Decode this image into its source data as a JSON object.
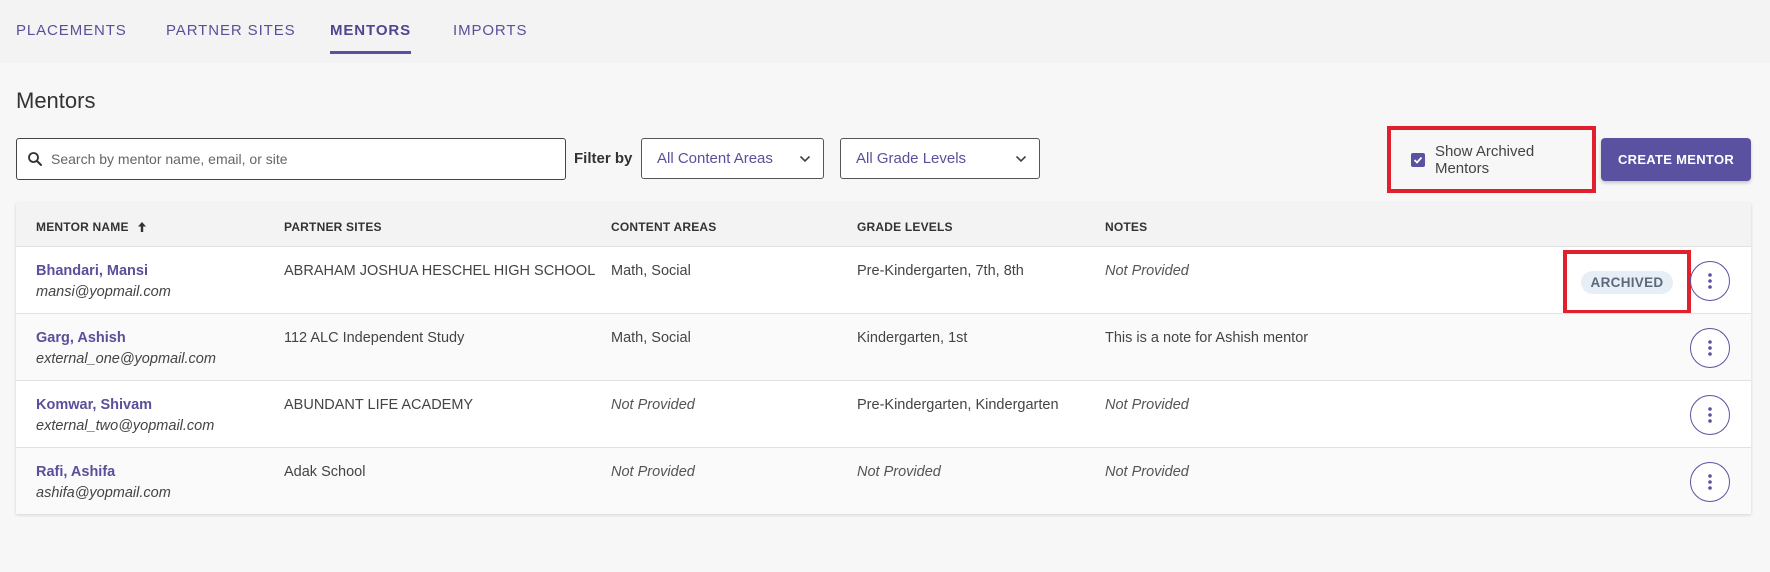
{
  "tabs": [
    {
      "label": "PLACEMENTS",
      "active": false
    },
    {
      "label": "PARTNER SITES",
      "active": false
    },
    {
      "label": "MENTORS",
      "active": true
    },
    {
      "label": "IMPORTS",
      "active": false
    }
  ],
  "page": {
    "title": "Mentors"
  },
  "toolbar": {
    "search_placeholder": "Search by mentor name, email, or site",
    "filter_label": "Filter by",
    "content_area_selected": "All Content Areas",
    "grade_level_selected": "All Grade Levels",
    "show_archived_label": "Show Archived Mentors",
    "show_archived_checked": true,
    "create_label": "CREATE MENTOR"
  },
  "table": {
    "headers": {
      "name": "MENTOR NAME",
      "sites": "PARTNER SITES",
      "content": "CONTENT AREAS",
      "grades": "GRADE LEVELS",
      "notes": "NOTES"
    },
    "rows": [
      {
        "name": "Bhandari, Mansi",
        "email": "mansi@yopmail.com",
        "sites": "ABRAHAM JOSHUA HESCHEL HIGH SCHOOL",
        "content": "Math, Social",
        "grades": "Pre-Kindergarten, 7th, 8th",
        "notes": "Not Provided",
        "status": "ARCHIVED"
      },
      {
        "name": "Garg, Ashish",
        "email": "external_one@yopmail.com",
        "sites": "112 ALC Independent Study",
        "content": "Math, Social",
        "grades": "Kindergarten, 1st",
        "notes": "This is a note for Ashish mentor"
      },
      {
        "name": "Komwar, Shivam",
        "email": "external_two@yopmail.com",
        "sites": "ABUNDANT LIFE ACADEMY",
        "content": "Not Provided",
        "grades": "Pre-Kindergarten, Kindergarten",
        "notes": "Not Provided"
      },
      {
        "name": "Rafi, Ashifa",
        "email": "ashifa@yopmail.com",
        "sites": "Adak School",
        "content": "Not Provided",
        "grades": "Not Provided",
        "notes": "Not Provided"
      }
    ]
  },
  "colors": {
    "brand": "#5a52a0",
    "highlight": "#e0202c",
    "badge_bg": "#e8eef5"
  }
}
